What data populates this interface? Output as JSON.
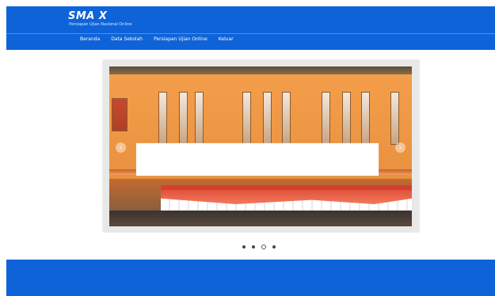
{
  "header": {
    "logo_title": "SMA X",
    "logo_subtitle": "Persiapan Ujian Nasional Online",
    "brand_color": "#0e63d8"
  },
  "nav": {
    "items": [
      {
        "label": "Beranda"
      },
      {
        "label": "Data Sekolah"
      },
      {
        "label": "Persiapan Ujian Online"
      },
      {
        "label": "Keluar"
      }
    ]
  },
  "slider": {
    "prev_icon": "chevron-left-icon",
    "next_icon": "chevron-right-icon",
    "prev_symbol": "‹",
    "next_symbol": "›",
    "slide_count": 4,
    "active_index": 2
  },
  "footer": {
    "color": "#0e63d8"
  }
}
